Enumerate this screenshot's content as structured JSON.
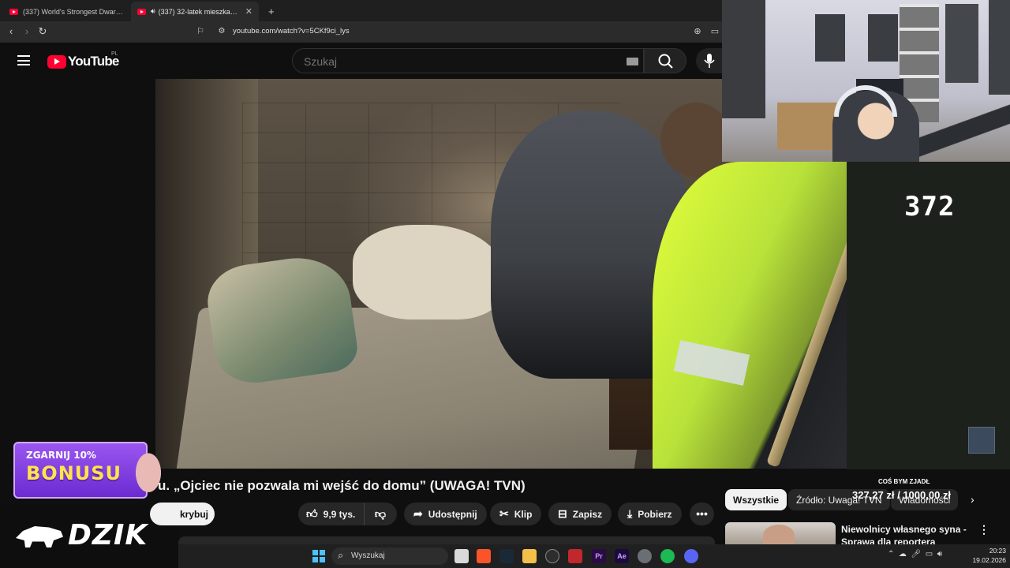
{
  "browser": {
    "tabs": [
      {
        "title": "(337) World's Strongest Dwarf Brutal",
        "active": false
      },
      {
        "title": "(337) 32-latek mieszka w kur",
        "active": true
      }
    ],
    "new_tab": "+",
    "url": "youtube.com/watch?v=5CKf9ci_lys"
  },
  "youtube": {
    "logo_text": "YouTube",
    "region": "PL",
    "search_placeholder": "Szukaj"
  },
  "video": {
    "title": "u. „Ojciec nie pozwala mi wejść do domu” (UWAGA! TVN)",
    "subscribe_label": "krybuj",
    "actions": {
      "likes": "9,9 tys.",
      "share": "Udostępnij",
      "clip": "Klip",
      "save": "Zapisz",
      "download": "Pobierz",
      "more": "•••"
    }
  },
  "overlay": {
    "counter": "372",
    "promo_line1": "ZGARNIJ 10%",
    "promo_line2": "BONUSU",
    "brand": "DZIK",
    "goal_label": "COŚ BYM ZJADŁ",
    "goal_amount": "327,27 zł / 1000,00 zł"
  },
  "sidebar": {
    "chips": [
      "Wszystkie",
      "Źródło: Uwaga! TVN",
      "Wiadomości"
    ],
    "recommended": {
      "title": "Niewolnicy własnego syna - Sprawa dla reportera"
    }
  },
  "taskbar": {
    "search": "Wyszukaj",
    "time": "20:23",
    "date": "19.02.2026"
  },
  "colors": {
    "accent": "#ff0033",
    "promo": "#7e3ae0",
    "promo_text": "#ffe44d"
  }
}
